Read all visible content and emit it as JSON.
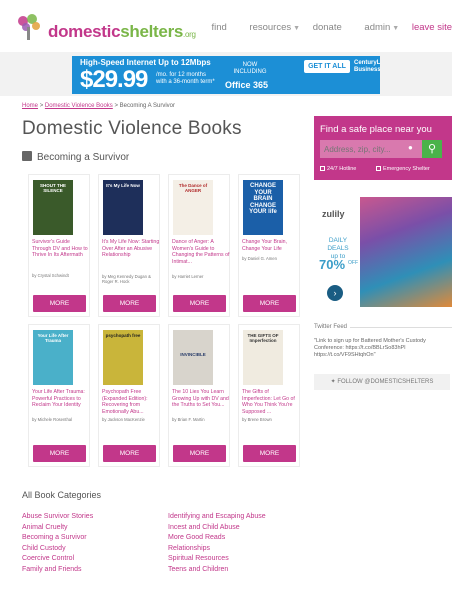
{
  "header": {
    "logo_main": "domestic",
    "logo_second": "shelters",
    "logo_tld": ".org",
    "nav": [
      {
        "label": "find",
        "caret": false
      },
      {
        "label": "resources",
        "caret": true
      },
      {
        "label": "donate",
        "caret": false
      },
      {
        "label": "admin",
        "caret": true
      },
      {
        "label": "leave site",
        "caret": false
      }
    ]
  },
  "ad_banner": {
    "line1": "High-Speed Internet Up to 12Mbps",
    "price": "$29.99",
    "price_suffix": "/mo. for 12 months with a 36-month term*",
    "now_including": "NOW INCLUDING",
    "office": "Office 365",
    "cta": "GET IT ALL",
    "brand": "CenturyLink Business"
  },
  "breadcrumb": {
    "home": "Home",
    "sep1": ">",
    "section": "Domestic Violence Books",
    "sep2": ">",
    "current": "Becoming A Survivor"
  },
  "page": {
    "title": "Domestic Violence Books",
    "subtitle": "Becoming a Survivor"
  },
  "books": [
    {
      "title": "Survivor's Guide Through DV and How to Thrive In Its Aftermath",
      "author": "by Crystal Schwindt",
      "cover_title": "SHOUT THE SILENCE",
      "cover_color": "#3a5a2a",
      "more": "MORE"
    },
    {
      "title": "It's My Life Now: Starting Over After an Abusive Relationship",
      "author": "by Meg Kennedy Dugan & Roger R. Hock",
      "cover_title": "It's My Life Now",
      "cover_color": "#1e2f5a",
      "more": "MORE"
    },
    {
      "title": "Dance of Anger: A Women's Guide to Changing the Patterns of Intimat...",
      "author": "by Harriet Lerner",
      "cover_title": "The Dance of ANGER",
      "cover_color": "#f4efe6",
      "more": "MORE"
    },
    {
      "title": "Change Your Brain, Change Your Life",
      "author": "by Daniel G. Amen",
      "cover_title": "CHANGE YOUR BRAIN CHANGE YOUR life",
      "cover_color": "#1b5fa8",
      "more": "MORE"
    },
    {
      "title": "Your Life After Trauma: Powerful Practices to Reclaim Your Identity",
      "author": "by Michele Rosenthal",
      "cover_title": "Your Life After Trauma",
      "cover_color": "#4ab0c9",
      "more": "MORE"
    },
    {
      "title": "Psychopath Free (Expanded Edition): Recovering from Emotionally Abu...",
      "author": "by Jackson MacKenzie",
      "cover_title": "psychopath free",
      "cover_color": "#c9b53a",
      "more": "MORE"
    },
    {
      "title": "The 10 Lies You Learn Growing Up with DV and the Truths to Set You...",
      "author": "by Brian F. Martin",
      "cover_title": "INVINCIBLE",
      "cover_color": "#d8d4cc",
      "more": "MORE"
    },
    {
      "title": "The Gifts of Imperfection: Let Go of Who You Think You're Supposed ...",
      "author": "by Brene Brown",
      "cover_title": "THE GIFTS OF Imperfection",
      "cover_color": "#f0ebe0",
      "more": "MORE"
    }
  ],
  "categories": {
    "heading": "All Book Categories",
    "left": [
      "Abuse Survivor Stories",
      "Animal Cruelty",
      "Becoming a Survivor",
      "Child Custody",
      "Coercive Control",
      "Family and Friends"
    ],
    "right": [
      "Identifying and Escaping Abuse",
      "Incest and Child Abuse",
      "More Good Reads",
      "Relationships",
      "Spiritual Resources",
      "Teens and Children"
    ]
  },
  "sidebar": {
    "find_heading": "Find a safe place near you",
    "search_placeholder": "Address, zip, city...",
    "hotline": "24/7 Hotline",
    "emergency": "Emergency Shelter",
    "ad": {
      "brand": "zulily",
      "daily_deals": "DAILY DEALS",
      "up_to": "up to",
      "percent": "70%",
      "off": "OFF"
    },
    "twitter_heading": "Twitter Feed",
    "tweet": "\"Link to sign up for Battered Mother's Custody Conference: https://t.co/BBLrSo83hPl https://t.co/VF9SHtqhOn\"",
    "follow": "FOLLOW @DOMESTICSHELTERS"
  },
  "colors": {
    "brand_pink": "#c2378a",
    "brand_green": "#7ab648",
    "go_green": "#4ab34a",
    "ad_blue": "#1c8fd6"
  }
}
